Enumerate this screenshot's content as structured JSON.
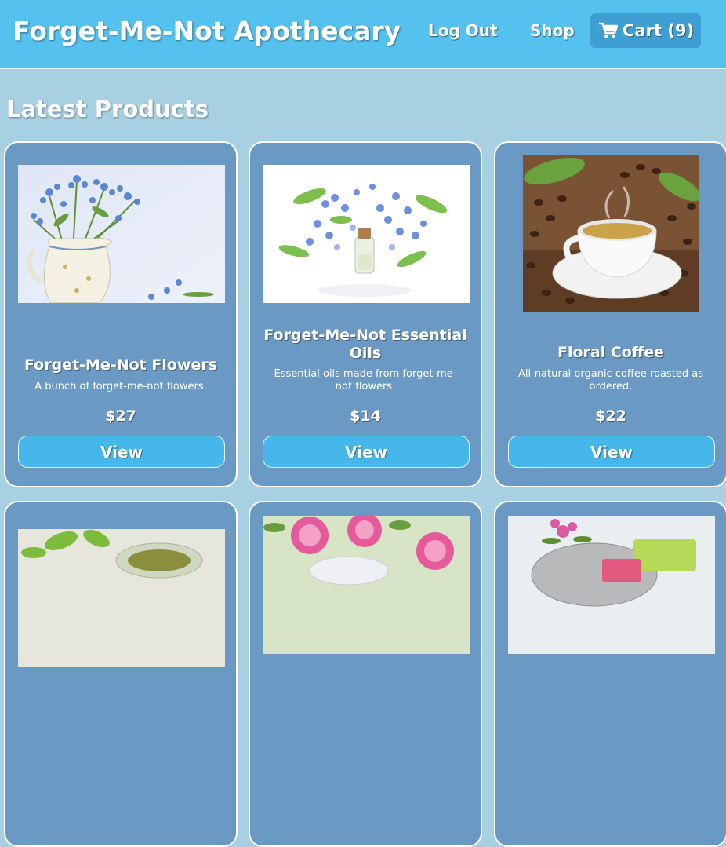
{
  "header": {
    "brand": "Forget-Me-Not Apothecary",
    "nav": {
      "logout": "Log Out",
      "shop": "Shop",
      "cart": "Cart (9)"
    }
  },
  "main": {
    "title": "Latest Products",
    "products": [
      {
        "name": "Forget-Me-Not Flowers",
        "description": "A bunch of forget-me-not flowers.",
        "price": "$27",
        "button": "View",
        "image": "forget-me-not-pitcher-photo"
      },
      {
        "name": "Forget-Me-Not Essential Oils",
        "description": "Essential oils made from forget-me-not flowers.",
        "price": "$14",
        "button": "View",
        "image": "essential-oil-bottle-photo"
      },
      {
        "name": "Floral Coffee",
        "description": "All-natural organic coffee roasted as ordered.",
        "price": "$22",
        "button": "View",
        "image": "coffee-cup-beans-photo"
      },
      {
        "name": "",
        "description": "",
        "price": "",
        "button": "",
        "image": "herbal-tea-photo"
      },
      {
        "name": "",
        "description": "",
        "price": "",
        "button": "",
        "image": "pink-roses-photo"
      },
      {
        "name": "",
        "description": "",
        "price": "",
        "button": "",
        "image": "soap-bars-photo"
      }
    ]
  },
  "colors": {
    "header": "#55c1ef",
    "page": "#a7d0e2",
    "card": "#6a9ac4",
    "button": "#46b7ea"
  }
}
